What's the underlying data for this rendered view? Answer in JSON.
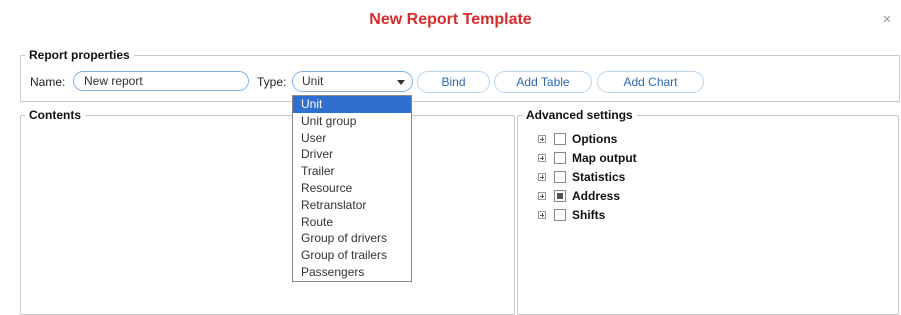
{
  "dialog": {
    "title": "New Report Template",
    "close_glyph": "×"
  },
  "report_properties": {
    "legend": "Report properties",
    "name_label": "Name:",
    "name_value": "New report",
    "type_label": "Type:",
    "type_value": "Unit",
    "buttons": {
      "bind": "Bind",
      "add_table": "Add Table",
      "add_chart": "Add Chart"
    }
  },
  "type_dropdown": {
    "selected": "Unit",
    "options": [
      "Unit",
      "Unit group",
      "User",
      "Driver",
      "Trailer",
      "Resource",
      "Retranslator",
      "Route",
      "Group of drivers",
      "Group of trailers",
      "Passengers"
    ]
  },
  "contents": {
    "legend": "Contents"
  },
  "advanced_settings": {
    "legend": "Advanced settings",
    "items": [
      {
        "label": "Options",
        "checked": "unchecked"
      },
      {
        "label": "Map output",
        "checked": "unchecked"
      },
      {
        "label": "Statistics",
        "checked": "unchecked"
      },
      {
        "label": "Address",
        "checked": "partial"
      },
      {
        "label": "Shifts",
        "checked": "unchecked"
      }
    ]
  },
  "icons": {
    "close": "close-icon",
    "dropdown_arrow": "chevron-down-icon",
    "expander": "plus-box-icon"
  },
  "colors": {
    "title": "#d92b2b",
    "accent_border": "#7fb3e6",
    "button_text": "#2b69b1",
    "selected_option_bg": "#2f6fd0"
  }
}
